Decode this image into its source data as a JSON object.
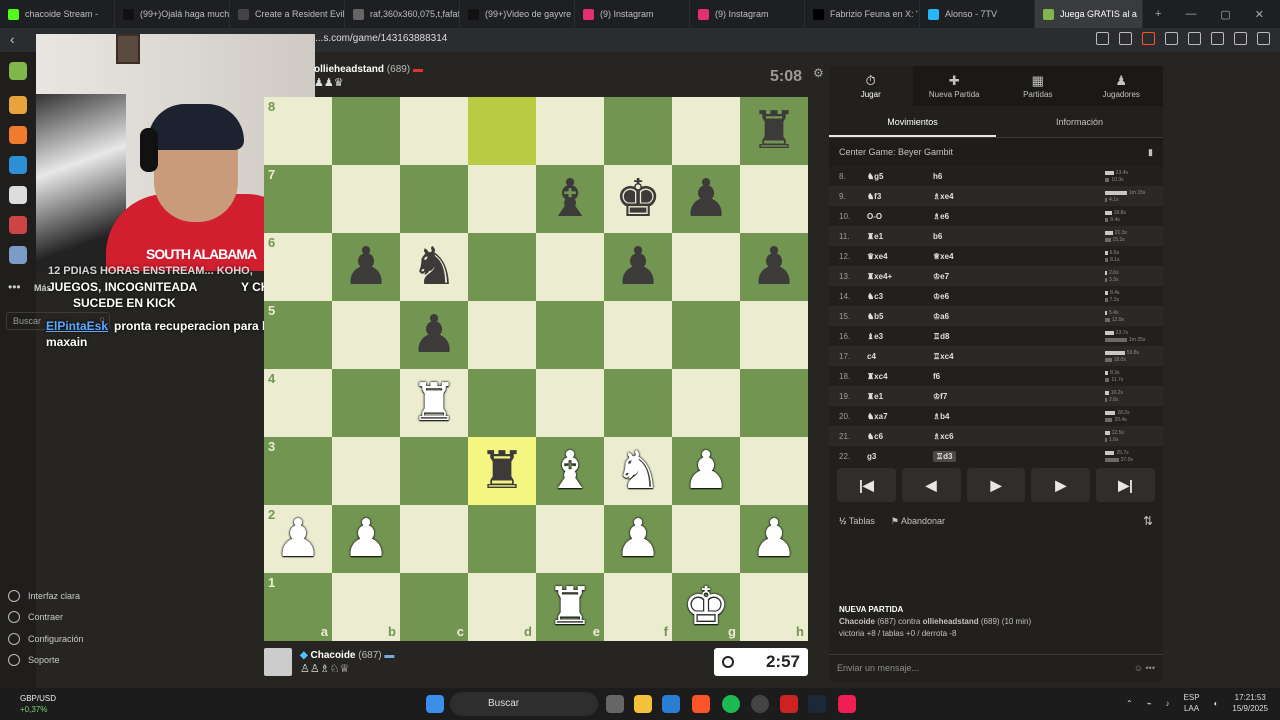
{
  "browser": {
    "tabs": [
      {
        "label": "chacoide Stream -",
        "color": "#53fc18"
      },
      {
        "label": "(99+)Ojalá haga much",
        "color": "#111111"
      },
      {
        "label": "Create a Resident Evil",
        "color": "#444444"
      },
      {
        "label": "raf,360x360,075,t,fafaf",
        "color": "#666666"
      },
      {
        "label": "(99+)Video de gayvre",
        "color": "#111111"
      },
      {
        "label": "(9) Instagram",
        "color": "#e1306c"
      },
      {
        "label": "(9) Instagram",
        "color": "#e1306c"
      },
      {
        "label": "Fabrizio Feuna en X: '",
        "color": "#000000"
      },
      {
        "label": "Alonso - 7TV",
        "color": "#29b6f6"
      },
      {
        "label": "Juega GRATIS al a",
        "color": "#81b64c",
        "active": true
      }
    ],
    "url": "...s.com/game/143163888314"
  },
  "stream_overlay": {
    "shirt_text": "SOUTH ALABAMA",
    "chat": {
      "line1": "12 PDIAS HORAS ENSTREAM... KOHO,",
      "line2": "JUEGOS, INCOGNITEADA",
      "line2b": "Y CHILLING",
      "line3": "SUCEDE EN KICK",
      "user": "ElPintaEsk",
      "msg1": "pronta recuperacion para la pc de",
      "msg2": "maxain"
    },
    "nav_more": "Más",
    "search_placeholder": "Buscar"
  },
  "left_bottom": [
    {
      "label": "Interfaz clara"
    },
    {
      "label": "Contraer"
    },
    {
      "label": "Configuración"
    },
    {
      "label": "Soporte"
    }
  ],
  "game": {
    "top_player": {
      "name": "ollieheadstand",
      "rating": "(689)",
      "clock": "5:08"
    },
    "bottom_player": {
      "name": "Chacoide",
      "rating": "(687)",
      "clock": "2:57"
    },
    "rank_labels": [
      "8",
      "7",
      "6",
      "5",
      "4",
      "3",
      "2",
      "1"
    ],
    "file_labels": [
      "a",
      "b",
      "c",
      "d",
      "e",
      "f",
      "g",
      "h"
    ],
    "board": [
      [
        "",
        "",
        "",
        "",
        "",
        "",
        "",
        "bR"
      ],
      [
        "",
        "",
        "",
        "",
        "bB",
        "bK",
        "bP",
        ""
      ],
      [
        "",
        "bP",
        "bN",
        "",
        "",
        "bP",
        "",
        "bP"
      ],
      [
        "",
        "",
        "bP",
        "",
        "",
        "",
        "",
        ""
      ],
      [
        "",
        "",
        "wR",
        "",
        "",
        "",
        "",
        ""
      ],
      [
        "",
        "",
        "",
        "bR",
        "wB",
        "wN",
        "wP",
        ""
      ],
      [
        "wP",
        "wP",
        "",
        "",
        "",
        "wP",
        "",
        "wP"
      ],
      [
        "",
        "",
        "",
        "",
        "wR",
        "",
        "wK",
        ""
      ]
    ],
    "highlights": [
      [
        0,
        3
      ],
      [
        5,
        3
      ]
    ]
  },
  "panel": {
    "tabs": [
      {
        "label": "Jugar",
        "glyph": "⏱"
      },
      {
        "label": "Nueva Partida",
        "glyph": "✚"
      },
      {
        "label": "Partidas",
        "glyph": "▦"
      },
      {
        "label": "Jugadores",
        "glyph": "♟"
      }
    ],
    "subtabs": [
      "Movimientos",
      "Información"
    ],
    "opening": "Center Game: Beyer Gambit",
    "moves": [
      {
        "n": "8.",
        "w": "♞g5",
        "b": "h6",
        "tw": "23.4s",
        "tb": "10.3s",
        "fw": 0.4,
        "fb": 0.2
      },
      {
        "n": "9.",
        "w": "♞f3",
        "b": "♗xe4",
        "tw": "1m 15s",
        "tb": "4.1s",
        "fw": 1.0,
        "fb": 0.08
      },
      {
        "n": "10.",
        "w": "O-O",
        "b": "♗e6",
        "tw": "18.8s",
        "tb": "8.4s",
        "fw": 0.3,
        "fb": 0.15
      },
      {
        "n": "11.",
        "w": "♜e1",
        "b": "b6",
        "tw": "21.3s",
        "tb": "15.2s",
        "fw": 0.35,
        "fb": 0.25
      },
      {
        "n": "12.",
        "w": "♛xe4",
        "b": "♕xe4",
        "tw": "6.6s",
        "tb": "8.1s",
        "fw": 0.12,
        "fb": 0.14
      },
      {
        "n": "13.",
        "w": "♜xe4+",
        "b": "♔e7",
        "tw": "2.6s",
        "tb": "3.3s",
        "fw": 0.05,
        "fb": 0.06
      },
      {
        "n": "14.",
        "w": "♞c3",
        "b": "♔e6",
        "tw": "8.4s",
        "tb": "7.3s",
        "fw": 0.14,
        "fb": 0.12
      },
      {
        "n": "15.",
        "w": "♞b5",
        "b": "♔a6",
        "tw": "5.4s",
        "tb": "12.9s",
        "fw": 0.09,
        "fb": 0.22
      },
      {
        "n": "16.",
        "w": "♝e3",
        "b": "♖d8",
        "tw": "23.7s",
        "tb": "1m 25s",
        "fw": 0.4,
        "fb": 1.0
      },
      {
        "n": "17.",
        "w": "c4",
        "b": "♖xc4",
        "tw": "59.8s",
        "tb": "18.0s",
        "fw": 0.9,
        "fb": 0.3
      },
      {
        "n": "18.",
        "w": "♜xc4",
        "b": "f6",
        "tw": "8.3s",
        "tb": "11.7s",
        "fw": 0.14,
        "fb": 0.2
      },
      {
        "n": "19.",
        "w": "♜e1",
        "b": "♔f7",
        "tw": "10.2s",
        "tb": "2.8s",
        "fw": 0.17,
        "fb": 0.05
      },
      {
        "n": "20.",
        "w": "♞xa7",
        "b": "♗b4",
        "tw": "28.2s",
        "tb": "20.4s",
        "fw": 0.47,
        "fb": 0.34
      },
      {
        "n": "21.",
        "w": "♞c6",
        "b": "♗xc6",
        "tw": "12.5s",
        "tb": "1.6s",
        "fw": 0.21,
        "fb": 0.03
      },
      {
        "n": "22.",
        "w": "g3",
        "b": "♖d3",
        "tw": "25.7s",
        "tb": "37.0s",
        "fw": 0.43,
        "fb": 0.62,
        "current": true
      }
    ],
    "nav": [
      "|◀",
      "◀",
      "▶",
      "▶",
      "▶|"
    ],
    "draw_label": "Tablas",
    "resign_label": "Abandonar",
    "new_game_title": "NUEVA PARTIDA",
    "new_game_line1_a": "Chacoide",
    "new_game_line1_b": "(687) contra",
    "new_game_line1_c": "ollieheadstand",
    "new_game_line1_d": "(689) (10 min)",
    "new_game_line2": "victoria +8 / tablas +0 / derrota -8",
    "chat_placeholder": "Enviar un mensaje..."
  },
  "taskbar": {
    "ticker": "GBP/USD",
    "ticker_change": "+0,37%",
    "search": "Buscar",
    "lang1": "ESP",
    "lang2": "LAA",
    "time": "17:21:53",
    "date": "15/9/2025"
  },
  "colors": {
    "board_light": "#ebecd0",
    "board_dark": "#739552",
    "highlight": "#f5f682",
    "accent": "#81b64c"
  }
}
